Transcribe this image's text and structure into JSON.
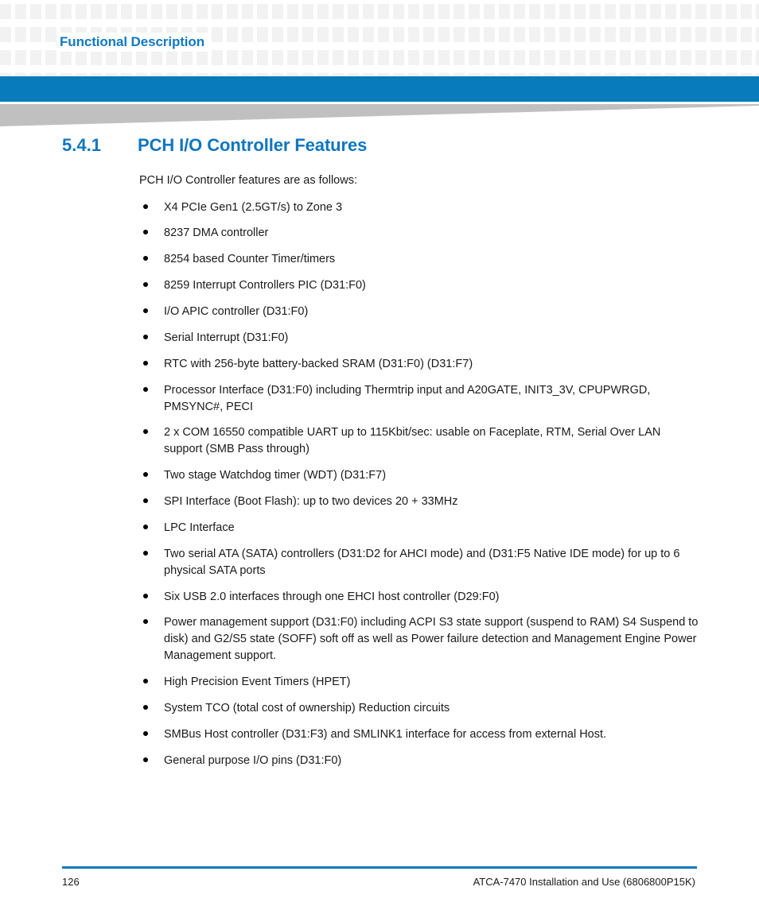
{
  "header": {
    "running_head": "Functional Description",
    "accent_blue": "#077bbc",
    "heading_blue": "#0f76bf",
    "wedge_gray": "#c0c0c0"
  },
  "section": {
    "number": "5.4.1",
    "title": "PCH I/O Controller Features",
    "intro": "PCH I/O Controller features are as follows:"
  },
  "features": [
    "X4 PCIe Gen1 (2.5GT/s) to Zone 3",
    "8237 DMA controller",
    "8254 based Counter Timer/timers",
    "8259 Interrupt Controllers PIC (D31:F0)",
    "I/O APIC controller (D31:F0)",
    "Serial Interrupt (D31:F0)",
    "RTC with 256-byte battery-backed SRAM (D31:F0) (D31:F7)",
    "Processor Interface (D31:F0) including Thermtrip input and A20GATE, INIT3_3V, CPUPWRGD, PMSYNC#, PECI",
    "2 x COM 16550 compatible UART up to 115Kbit/sec: usable on Faceplate, RTM, Serial Over LAN support (SMB Pass through)",
    "Two stage Watchdog timer (WDT) (D31:F7)",
    "SPI Interface (Boot Flash): up to two devices 20 + 33MHz",
    "LPC Interface",
    "Two serial ATA (SATA) controllers (D31:D2 for AHCI mode) and (D31:F5 Native IDE mode) for up to 6 physical SATA ports",
    "Six USB 2.0 interfaces through one EHCI host controller (D29:F0)",
    "Power management support (D31:F0) including ACPI S3 state support (suspend to RAM) S4 Suspend to disk) and G2/S5 state (SOFF) soft off as well as Power failure detection and Management Engine Power Management support.",
    "High Precision Event Timers (HPET)",
    "System TCO (total cost of ownership) Reduction circuits",
    "SMBus Host controller (D31:F3) and SMLINK1 interface for access from external Host.",
    "General purpose I/O pins (D31:F0)"
  ],
  "footer": {
    "page_number": "126",
    "document": "ATCA-7470 Installation and Use (6806800P15K)"
  }
}
